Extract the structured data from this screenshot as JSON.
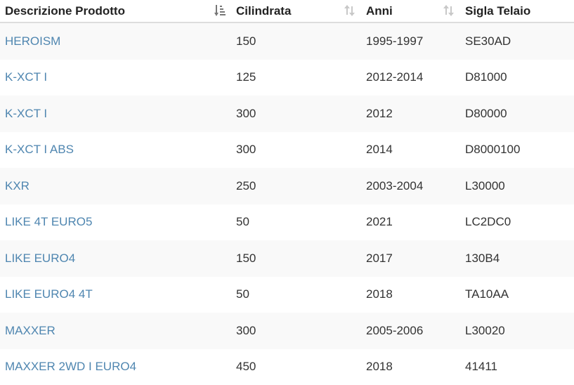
{
  "table": {
    "columns": [
      {
        "label": "Descrizione Prodotto",
        "sort_icon": "sort-amount-down-icon",
        "sorted": true
      },
      {
        "label": "Cilindrata",
        "sort_icon": "sort-icon",
        "sorted": false
      },
      {
        "label": "Anni",
        "sort_icon": "sort-icon",
        "sorted": false
      },
      {
        "label": "Sigla Telaio",
        "sort_icon": "none",
        "sorted": false
      }
    ],
    "rows": [
      {
        "product": "HEROISM",
        "cc": "150",
        "years": "1995-1997",
        "frame": "SE30AD"
      },
      {
        "product": "K-XCT I",
        "cc": "125",
        "years": "2012-2014",
        "frame": "D81000"
      },
      {
        "product": "K-XCT I",
        "cc": "300",
        "years": "2012",
        "frame": "D80000"
      },
      {
        "product": "K-XCT I ABS",
        "cc": "300",
        "years": "2014",
        "frame": "D8000100"
      },
      {
        "product": "KXR",
        "cc": "250",
        "years": "2003-2004",
        "frame": "L30000"
      },
      {
        "product": "LIKE 4T EURO5",
        "cc": "50",
        "years": "2021",
        "frame": "LC2DC0"
      },
      {
        "product": "LIKE EURO4",
        "cc": "150",
        "years": "2017",
        "frame": "130B4"
      },
      {
        "product": "LIKE EURO4 4T",
        "cc": "50",
        "years": "2018",
        "frame": "TA10AA"
      },
      {
        "product": "MAXXER",
        "cc": "300",
        "years": "2005-2006",
        "frame": "L30020"
      },
      {
        "product": "MAXXER 2WD I EURO4",
        "cc": "450",
        "years": "2018",
        "frame": "41411"
      }
    ]
  },
  "colors": {
    "link": "#4f86b0",
    "stripe": "#f9f9f9",
    "header_border": "#dddddd"
  }
}
